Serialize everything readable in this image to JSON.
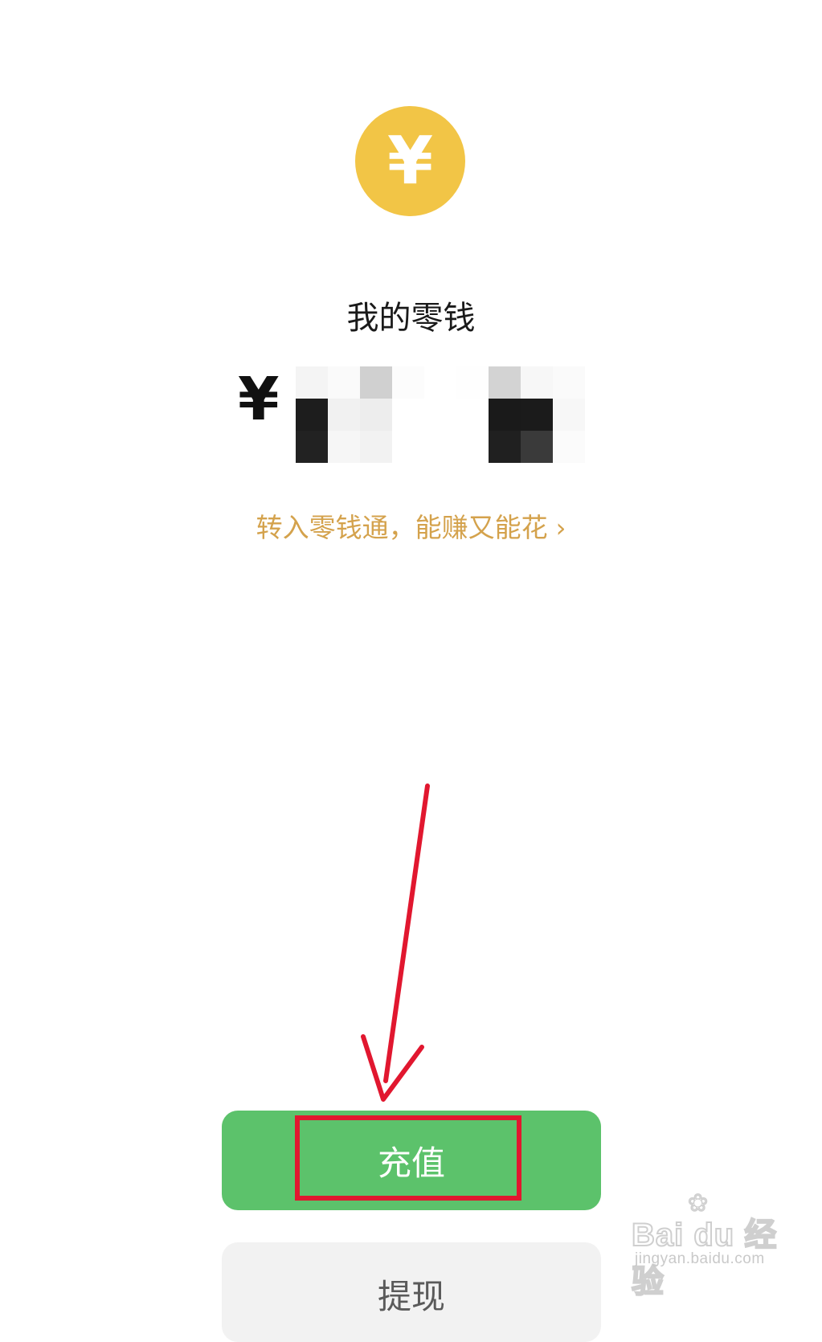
{
  "wallet": {
    "icon": "yuan-coin-icon",
    "coin_symbol": "¥",
    "title": "我的零钱",
    "currency_symbol": "¥",
    "balance_obscured": true,
    "promo_text": "转入零钱通，能赚又能花",
    "promo_chevron": "›"
  },
  "actions": {
    "recharge_label": "充值",
    "withdraw_label": "提现"
  },
  "annotation": {
    "arrow_color": "#e1172f",
    "highlight_color": "#e1172f"
  },
  "watermark": {
    "logo": "Bai du 经验",
    "url": "jingyan.baidu.com"
  },
  "colors": {
    "coin": "#f2c546",
    "primary_button": "#5cc26b",
    "promo": "#d4a24c",
    "secondary_button": "#f2f2f2"
  }
}
